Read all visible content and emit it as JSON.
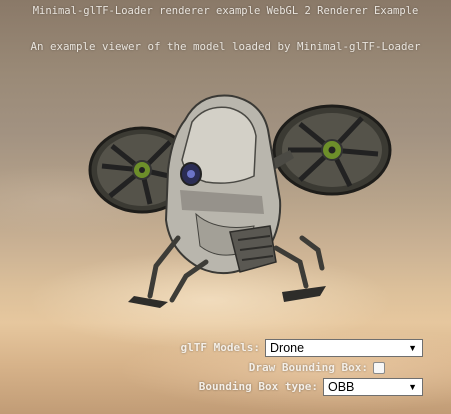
{
  "header": {
    "title": "Minimal-glTF-Loader renderer example WebGL 2 Renderer Example",
    "subtitle": "An example viewer of the model loaded by Minimal-glTF-Loader"
  },
  "controls": {
    "models_label": "glTF Models:",
    "models_selected": "Drone",
    "draw_bbox_label": "Draw Bounding Box:",
    "draw_bbox_checked": false,
    "bbox_type_label": "Bounding Box type:",
    "bbox_type_selected": "OBB"
  },
  "colors": {
    "text": "#e9e4dd",
    "drone_body": "#b9b6ad",
    "drone_dark": "#2e2d2a",
    "rotor_ring": "#3a3a30",
    "accent_green": "#6d8f2a"
  }
}
